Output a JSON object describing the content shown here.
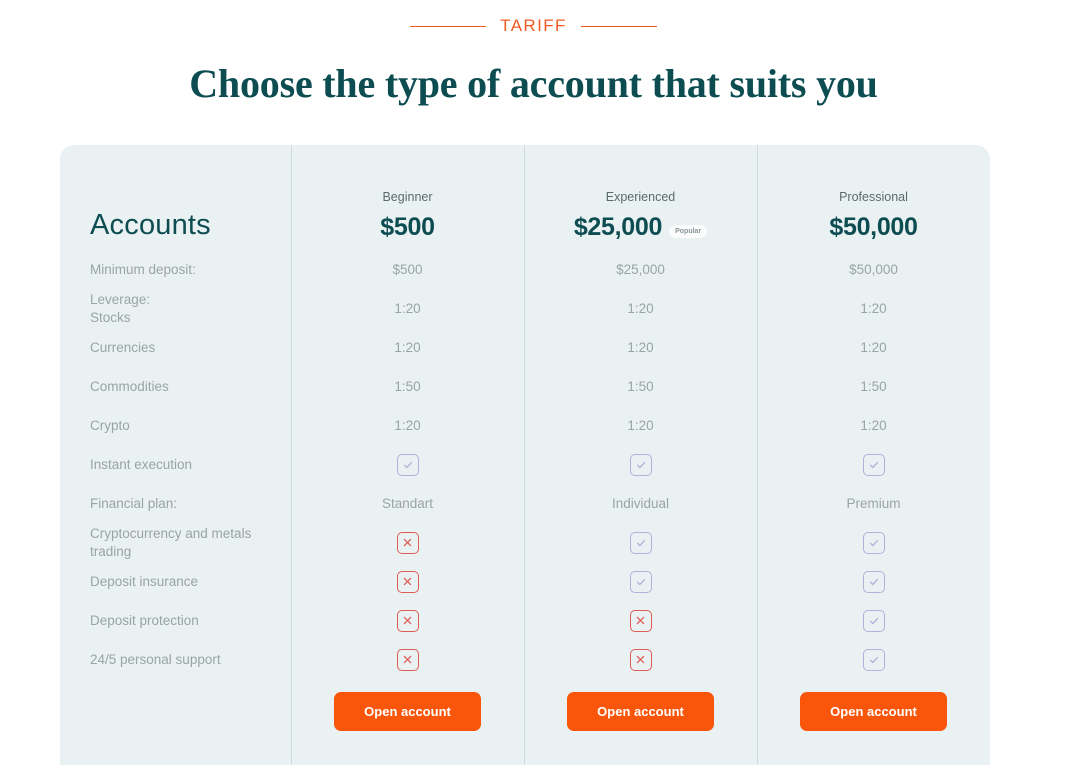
{
  "eyebrow": {
    "text": "TARIFF"
  },
  "headline": {
    "text": "Choose the type of account that suits you"
  },
  "table": {
    "corner_label": "Accounts",
    "columns": [
      {
        "name": "Beginner",
        "price": "$500",
        "badge": null,
        "cta": "Open account"
      },
      {
        "name": "Experienced",
        "price": "$25,000",
        "badge": "Popular",
        "cta": "Open account"
      },
      {
        "name": "Professional",
        "price": "$50,000",
        "badge": null,
        "cta": "Open account"
      }
    ],
    "rows": [
      {
        "label": "Minimum deposit:",
        "label2": "",
        "type": "text",
        "values": [
          "$500",
          "$25,000",
          "$50,000"
        ]
      },
      {
        "label": "Leverage:",
        "label2": "Stocks",
        "type": "text",
        "values": [
          "1:20",
          "1:20",
          "1:20"
        ]
      },
      {
        "label": "Currencies",
        "label2": "",
        "type": "text",
        "values": [
          "1:20",
          "1:20",
          "1:20"
        ]
      },
      {
        "label": "Commodities",
        "label2": "",
        "type": "text",
        "values": [
          "1:50",
          "1:50",
          "1:50"
        ]
      },
      {
        "label": "Crypto",
        "label2": "",
        "type": "text",
        "values": [
          "1:20",
          "1:20",
          "1:20"
        ]
      },
      {
        "label": "Instant execution",
        "label2": "",
        "type": "icon",
        "values": [
          "check",
          "check",
          "check"
        ]
      },
      {
        "label": "Financial plan:",
        "label2": "",
        "type": "text",
        "values": [
          "Standart",
          "Individual",
          "Premium"
        ]
      },
      {
        "label": "Cryptocurrency and metals",
        "label2": "trading",
        "type": "icon",
        "values": [
          "cross",
          "check",
          "check"
        ]
      },
      {
        "label": "Deposit insurance",
        "label2": "",
        "type": "icon",
        "values": [
          "cross",
          "check",
          "check"
        ]
      },
      {
        "label": "Deposit protection",
        "label2": "",
        "type": "icon",
        "values": [
          "cross",
          "cross",
          "check"
        ]
      },
      {
        "label": "24/5 personal support",
        "label2": "",
        "type": "icon",
        "values": [
          "cross",
          "cross",
          "check"
        ]
      }
    ]
  },
  "colors": {
    "accent_orange": "#f9560b",
    "eyebrow_orange": "#f05a22",
    "heading_teal": "#0d4d52",
    "card_bg": "#eaf1f2",
    "check_purple": "#b3b0da",
    "cross_red": "#e05b56"
  }
}
